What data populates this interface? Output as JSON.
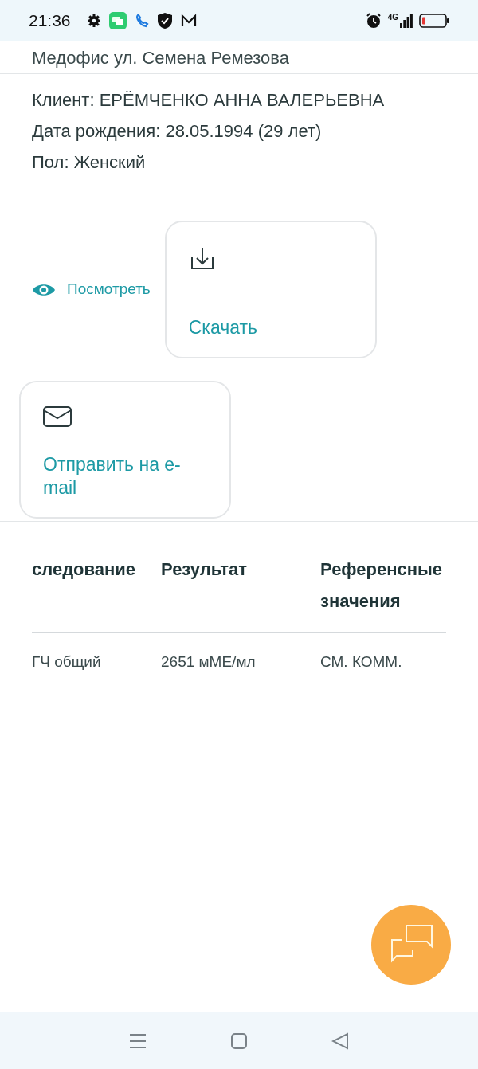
{
  "status_bar": {
    "time": "21:36",
    "network": "4G"
  },
  "header": {
    "office": "Медофис ул. Семена Ремезова"
  },
  "client": {
    "lines": [
      "Клиент: ЕРЁМЧЕНКО АННА ВАЛЕРЬЕВНА",
      "Дата рождения: 28.05.1994 (29 лет)",
      "Пол: Женский"
    ]
  },
  "actions": [
    {
      "kind": "link",
      "label": "Посмотреть"
    },
    {
      "kind": "card-download",
      "label": "Скачать"
    },
    {
      "kind": "card-email",
      "label": "Отправить на e-mail"
    }
  ],
  "table": {
    "columns": [
      "следование",
      "Результат",
      "Референсные значения"
    ],
    "rows": [
      [
        "ГЧ общий",
        "2651 мМЕ/мл",
        "СМ. КОММ."
      ]
    ]
  }
}
